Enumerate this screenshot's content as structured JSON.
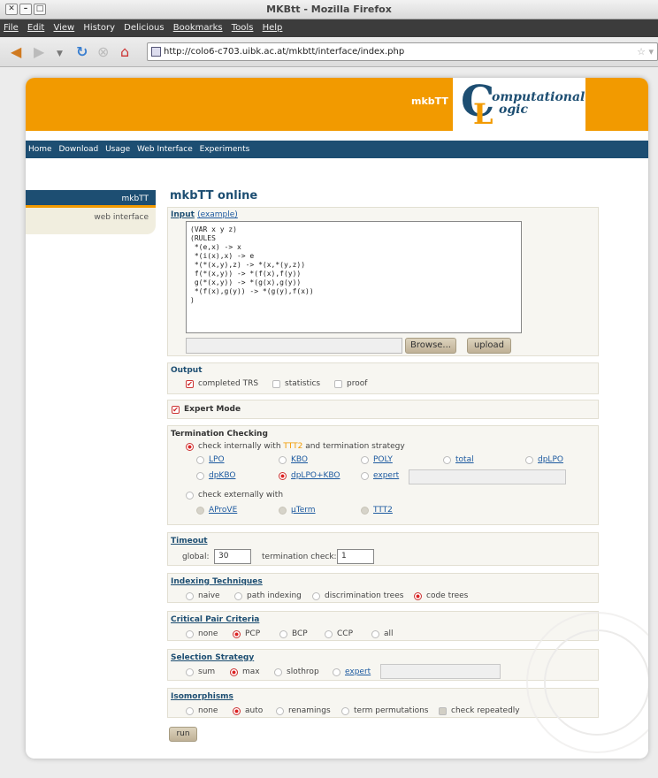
{
  "window": {
    "title": "MKBtt - Mozilla Firefox"
  },
  "menu": [
    "File",
    "Edit",
    "View",
    "History",
    "Delicious",
    "Bookmarks",
    "Tools",
    "Help"
  ],
  "url": "http://colo6-c703.uibk.ac.at/mkbtt/interface/index.php",
  "header": {
    "title": "mkbTT",
    "logo_letters": [
      "C",
      "L"
    ],
    "logo_line1": "omputational",
    "logo_line2": "ogic"
  },
  "sitenav": [
    "Home",
    "Download",
    "Usage",
    "Web Interface",
    "Experiments"
  ],
  "sidebar": {
    "active": "mkbTT",
    "sub": "web interface"
  },
  "page_title": "mkbTT online",
  "input": {
    "label": "Input",
    "example": "(example)",
    "text": "(VAR x y z)\n(RULES\n *(e,x) -> x\n *(i(x),x) -> e\n *(*(x,y),z) -> *(x,*(y,z))\n f(*(x,y)) -> *(f(x),f(y))\n g(*(x,y)) -> *(g(x),g(y))\n *(f(x),g(y)) -> *(g(y),f(x))\n)",
    "browse": "Browse...",
    "upload": "upload"
  },
  "output": {
    "label": "Output",
    "items": [
      "completed TRS",
      "statistics",
      "proof"
    ]
  },
  "expert": {
    "label": "Expert Mode"
  },
  "termination": {
    "label": "Termination Checking",
    "internal_a": "check internally with ",
    "internal_b": "TTT2",
    "internal_c": " and termination strategy",
    "row1": [
      "LPO",
      "KBO",
      "POLY",
      "total",
      "dpLPO"
    ],
    "row2": [
      "dpKBO",
      "dpLPO+KBO",
      "expert"
    ],
    "external": "check externally with",
    "ext_items": [
      "AProVE",
      "µTerm",
      "TTT2"
    ]
  },
  "timeout": {
    "label": "Timeout",
    "global_label": "global:",
    "global_value": "30",
    "term_label": "termination check:",
    "term_value": "1"
  },
  "indexing": {
    "label": "Indexing Techniques",
    "items": [
      "naive",
      "path indexing",
      "discrimination trees",
      "code trees"
    ]
  },
  "critical": {
    "label": "Critical Pair Criteria",
    "items": [
      "none",
      "PCP",
      "BCP",
      "CCP",
      "all"
    ]
  },
  "selection": {
    "label": "Selection Strategy",
    "items": [
      "sum",
      "max",
      "slothrop",
      "expert"
    ]
  },
  "iso": {
    "label": "Isomorphisms",
    "items": [
      "none",
      "auto",
      "renamings",
      "term permutations"
    ],
    "check": "check repeatedly"
  },
  "run": "run"
}
